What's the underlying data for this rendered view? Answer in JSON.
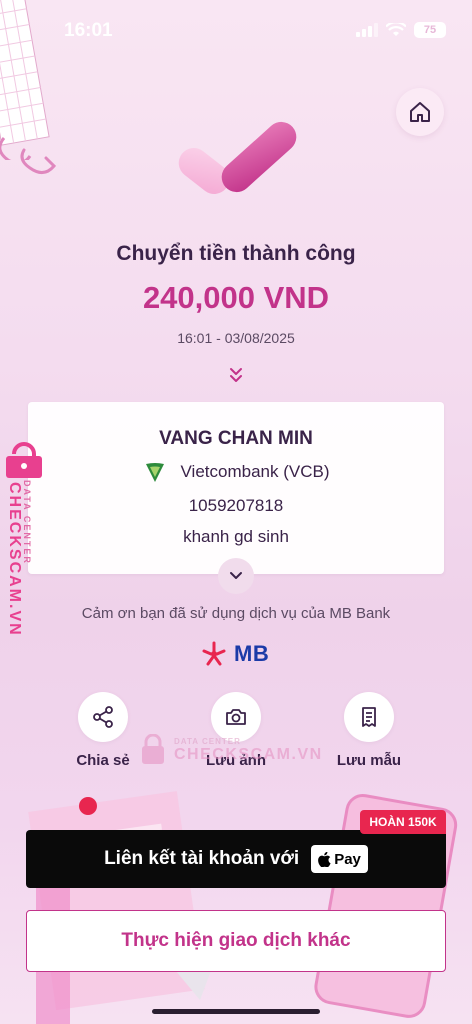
{
  "status_bar": {
    "time": "16:01",
    "battery": "75"
  },
  "header": {
    "home_icon": "home-icon"
  },
  "result": {
    "title": "Chuyển tiền thành công",
    "amount": "240,000 VND",
    "timestamp": "16:01 - 03/08/2025",
    "check_icon": "check-icon"
  },
  "recipient": {
    "name": "VANG CHAN MIN",
    "bank": "Vietcombank (VCB)",
    "account": "1059207818",
    "memo": "khanh gd sinh",
    "bank_logo_color": "#2e8b3c"
  },
  "thanks": "Cảm ơn bạn đã sử dụng dịch vụ của MB Bank",
  "brand": {
    "logo_text": "MB",
    "logo_color": "#1b3aa8",
    "star_color": "#e8264f"
  },
  "actions": [
    {
      "label": "Chia sẻ",
      "icon": "share-icon"
    },
    {
      "label": "Lưu ảnh",
      "icon": "camera-icon"
    },
    {
      "label": "Lưu mẫu",
      "icon": "receipt-icon"
    }
  ],
  "watermark": {
    "small": "DATA CENTER",
    "big": "CHECKSCAM.VN"
  },
  "promo": {
    "text": "Liên kết tài khoản với",
    "badge": "Pay",
    "ribbon": "HOÀN 150K"
  },
  "footer": {
    "other_transaction": "Thực hiện giao dịch khác"
  },
  "colors": {
    "accent": "#c2338a",
    "dark": "#3a2349",
    "red": "#e8264f"
  }
}
